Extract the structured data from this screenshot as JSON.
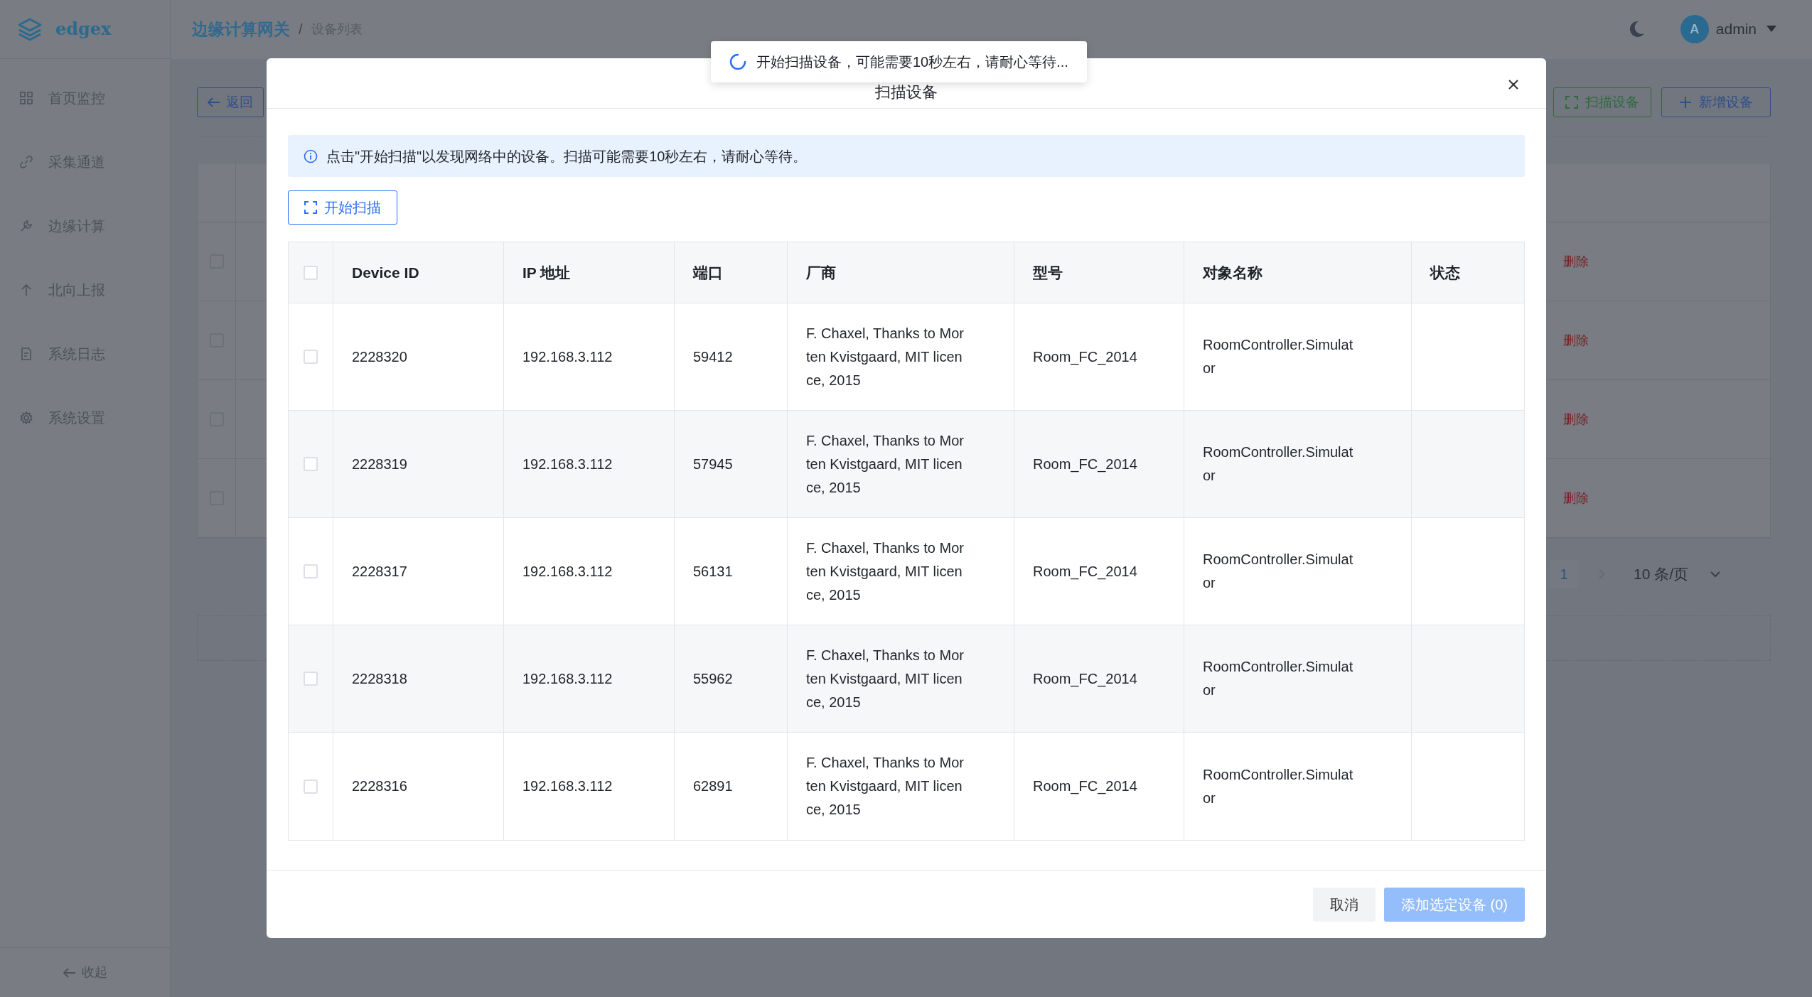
{
  "sidebar": {
    "logo": "edgex",
    "items": [
      {
        "label": "首页监控"
      },
      {
        "label": "采集通道"
      },
      {
        "label": "边缘计算"
      },
      {
        "label": "北向上报"
      },
      {
        "label": "系统日志"
      },
      {
        "label": "系统设置"
      }
    ],
    "collapse": "收起"
  },
  "header": {
    "breadcrumb": [
      "边缘计算网关",
      "设备列表"
    ],
    "separator": "/",
    "user": {
      "avatar": "A",
      "name": "admin"
    }
  },
  "page": {
    "back_button": "返回",
    "scan_button": "扫描设备",
    "add_button": "新增设备",
    "rows": [
      {
        "checked": false,
        "action": "删除"
      },
      {
        "checked": false,
        "action": "删除"
      },
      {
        "checked": false,
        "action": "删除"
      },
      {
        "checked": false,
        "action": "删除"
      }
    ],
    "pagination": {
      "page": "1",
      "page_size": "10 条/页"
    }
  },
  "toast": {
    "text": "开始扫描设备，可能需要10秒左右，请耐心等待..."
  },
  "dialog": {
    "title": "扫描设备",
    "info": "点击\"开始扫描\"以发现网络中的设备。扫描可能需要10秒左右，请耐心等待。",
    "scan_button": "开始扫描",
    "select_all": {
      "checked": false
    },
    "columns": [
      "Device ID",
      "IP 地址",
      "端口",
      "厂商",
      "型号",
      "对象名称",
      "状态"
    ],
    "rows": [
      {
        "checked": false,
        "cells": [
          "2228320",
          "192.168.3.112",
          "59412",
          "F. Chaxel, Thanks to Morten Kvistgaard, MIT licence, 2015",
          "Room_FC_2014",
          "RoomController.Simulator"
        ]
      },
      {
        "checked": false,
        "cells": [
          "2228319",
          "192.168.3.112",
          "57945",
          "F. Chaxel, Thanks to Morten Kvistgaard, MIT licence, 2015",
          "Room_FC_2014",
          "RoomController.Simulator"
        ]
      },
      {
        "checked": false,
        "cells": [
          "2228317",
          "192.168.3.112",
          "56131",
          "F. Chaxel, Thanks to Morten Kvistgaard, MIT licence, 2015",
          "Room_FC_2014",
          "RoomController.Simulator"
        ]
      },
      {
        "checked": false,
        "cells": [
          "2228318",
          "192.168.3.112",
          "55962",
          "F. Chaxel, Thanks to Morten Kvistgaard, MIT licence, 2015",
          "Room_FC_2014",
          "RoomController.Simulator"
        ]
      },
      {
        "checked": false,
        "cells": [
          "2228316",
          "192.168.3.112",
          "62891",
          "F. Chaxel, Thanks to Morten Kvistgaard, MIT licence, 2015",
          "Room_FC_2014",
          "RoomController.Simulator"
        ]
      }
    ],
    "cancel_button": "取消",
    "confirm_button": {
      "label": "添加选定设备 (0)",
      "disabled": true
    }
  }
}
